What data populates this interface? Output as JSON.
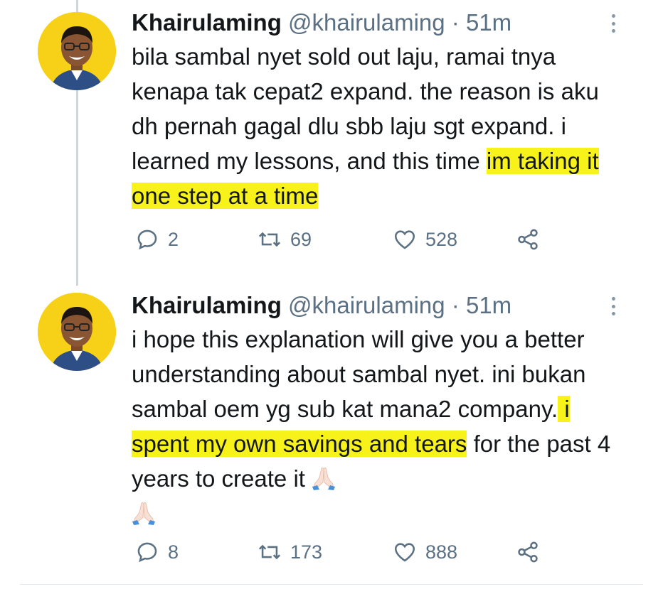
{
  "tweets": [
    {
      "name": "Khairulaming",
      "handle": "@khairulaming",
      "separator": "·",
      "time": "51m",
      "text_plain": "bila sambal nyet sold out laju, ramai tnya kenapa tak cepat2 expand. the reason is aku dh pernah gagal dlu sbb laju sgt expand. i learned my lessons, and this time ",
      "text_highlight": "im taking it one step at a time",
      "counts": {
        "replies": "2",
        "retweets": "69",
        "likes": "528"
      }
    },
    {
      "name": "Khairulaming",
      "handle": "@khairulaming",
      "separator": "·",
      "time": "51m",
      "text_plain": "i hope this explanation will give you a better understanding about sambal nyet. ini bukan sambal oem yg sub kat mana2 company.",
      "text_highlight": " i spent my own savings and tears",
      "text_after": " for the past 4 years to create it ",
      "emoji": "folded-hands",
      "counts": {
        "replies": "8",
        "retweets": "173",
        "likes": "888"
      }
    }
  ],
  "colors": {
    "highlight": "#f6f21a",
    "avatar_bg": "#f7d117",
    "muted": "#5b7083",
    "thread_line": "#ccd6dd"
  }
}
